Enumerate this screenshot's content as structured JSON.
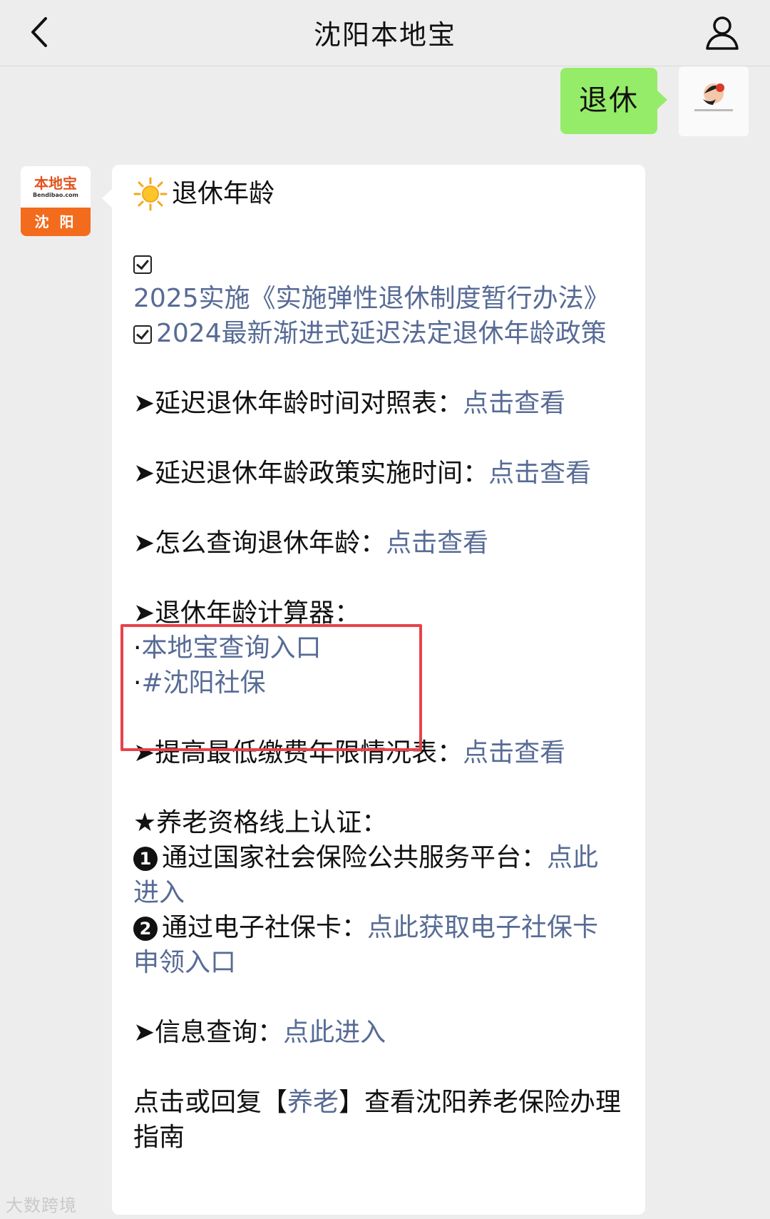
{
  "nav": {
    "title": "沈阳本地宝"
  },
  "chat": {
    "user_message": "退休",
    "bot_avatar": {
      "brand": "本地宝",
      "brand_sub": "Bendibao.com",
      "city": "沈 阳"
    },
    "reply": {
      "heading": "退休年龄",
      "policies": [
        {
          "text": "2025实施《实施弹性退休制度暂行办法》"
        },
        {
          "text": "2024最新渐进式延迟法定退休年龄政策"
        }
      ],
      "items": [
        {
          "prefix": "➤延迟退休年龄时间对照表：",
          "link": "点击查看"
        },
        {
          "prefix": "➤延迟退休年龄政策实施时间：",
          "link": "点击查看"
        },
        {
          "prefix": "➤怎么查询退休年龄：",
          "link": "点击查看"
        }
      ],
      "calculator": {
        "title": "➤退休年龄计算器：",
        "links": [
          {
            "bullet": "·",
            "text": "本地宝查询入口"
          },
          {
            "bullet": "·",
            "text": "#沈阳社保"
          }
        ]
      },
      "min_payment": {
        "prefix": "➤提高最低缴费年限情况表：",
        "link": "点击查看"
      },
      "certification": {
        "title": "★养老资格线上认证：",
        "steps": [
          {
            "num": "1",
            "prefix": "通过国家社会保险公共服务平台：",
            "link": "点此进入"
          },
          {
            "num": "2",
            "prefix": "通过电子社保卡：",
            "link": "点此获取电子社保卡申领入口"
          }
        ]
      },
      "info_query": {
        "prefix": "➤信息查询：",
        "link": "点此进入"
      },
      "footer": {
        "before": "点击或回复【",
        "keyword": "养老",
        "after": "】查看沈阳养老保险办理指南"
      }
    }
  },
  "watermark": "大数跨境",
  "colors": {
    "link": "#576b95",
    "self_bubble": "#95ec69",
    "highlight": "#e8424a",
    "brand_orange": "#f36b1c"
  }
}
